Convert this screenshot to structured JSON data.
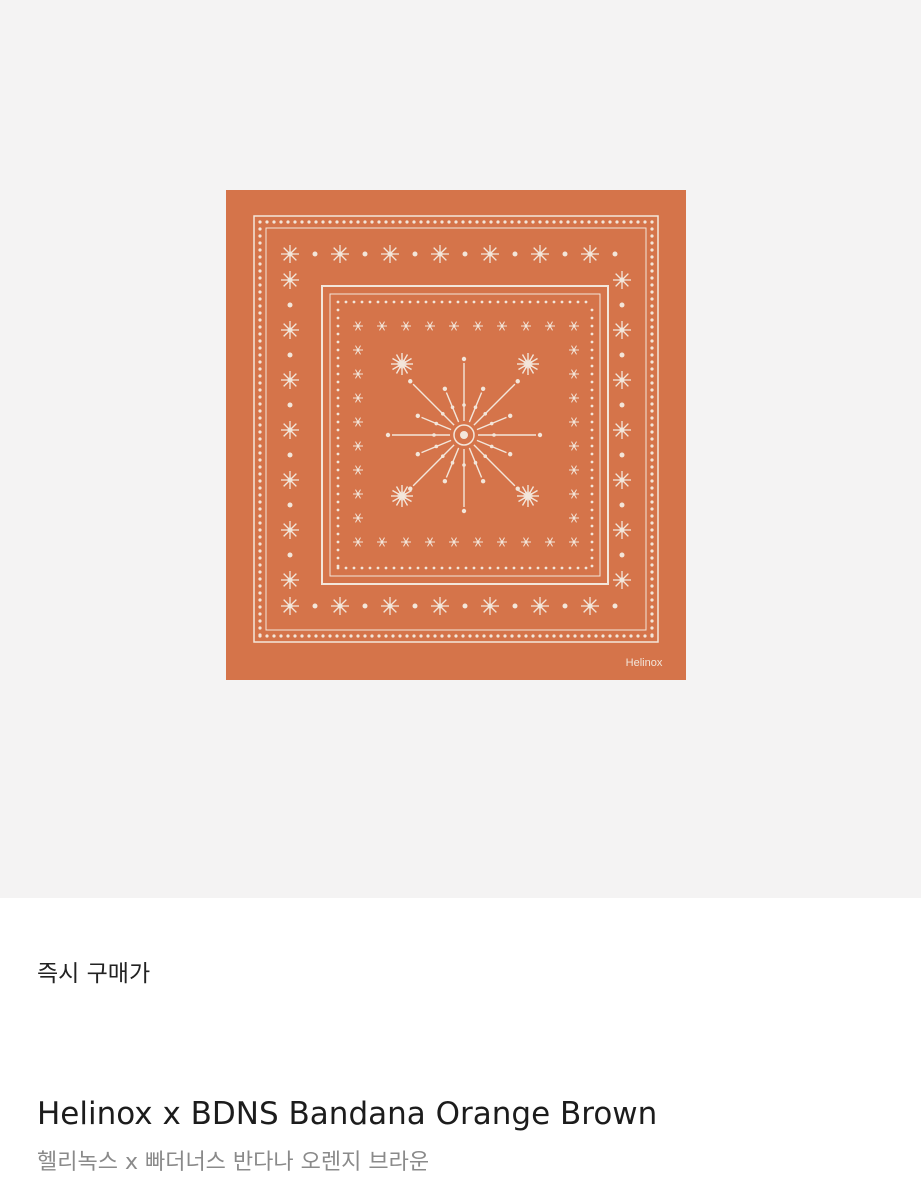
{
  "product": {
    "image_alt": "Helinox x BDNS Bandana Orange Brown",
    "bandana_color": "#d5744a",
    "pattern_color": "#f3e6da",
    "logo_text": "Helinox"
  },
  "price": {
    "label": "즉시 구매가",
    "value": ""
  },
  "title": {
    "english": "Helinox x BDNS Bandana Orange Brown",
    "korean": "헬리녹스 x 빠더너스 반다나 오렌지 브라운"
  }
}
